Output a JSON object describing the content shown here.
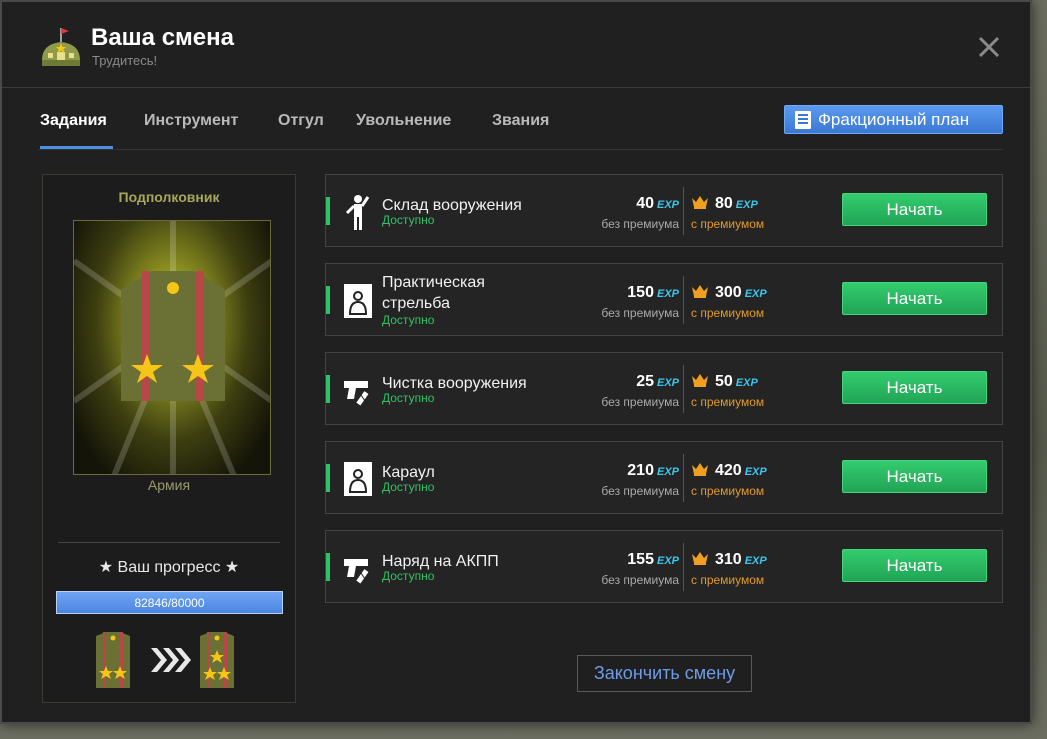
{
  "header": {
    "title": "Ваша смена",
    "subtitle": "Трудитесь!"
  },
  "tabs": [
    {
      "label": "Задания",
      "active": true
    },
    {
      "label": "Инструмент",
      "active": false
    },
    {
      "label": "Отгул",
      "active": false
    },
    {
      "label": "Увольнение",
      "active": false
    },
    {
      "label": "Звания",
      "active": false
    }
  ],
  "plan_button": {
    "label": "Фракционный план"
  },
  "rank": {
    "name": "Подполковник",
    "faction": "Армия",
    "progress_label": "Ваш прогресс",
    "progress_text": "82846/80000",
    "progress_fraction": 1.0
  },
  "tasks": [
    {
      "name": "Склад вооружения",
      "status": "Доступно",
      "base_exp": "40",
      "premium_exp": "80",
      "icon": "warehouse-worker-icon"
    },
    {
      "name": "Практическая стрельба",
      "status": "Доступно",
      "base_exp": "150",
      "premium_exp": "300",
      "icon": "shooting-target-icon"
    },
    {
      "name": "Чистка вооружения",
      "status": "Доступно",
      "base_exp": "25",
      "premium_exp": "50",
      "icon": "pistol-cleaning-icon"
    },
    {
      "name": "Караул",
      "status": "Доступно",
      "base_exp": "210",
      "premium_exp": "420",
      "icon": "shooting-target-icon"
    },
    {
      "name": "Наряд на АКПП",
      "status": "Доступно",
      "base_exp": "155",
      "premium_exp": "310",
      "icon": "pistol-cleaning-icon"
    }
  ],
  "labels": {
    "exp": "EXP",
    "without_premium": "без премиума",
    "with_premium": "с премиумом",
    "start": "Начать"
  },
  "finish_button": {
    "label": "Закончить смену"
  },
  "colors": {
    "accent_blue": "#4a8fe0",
    "start_green": "#2ec266",
    "exp_cyan": "#3cc8ee",
    "premium_orange": "#e29a2a",
    "rank_olive": "#a6a85a"
  }
}
